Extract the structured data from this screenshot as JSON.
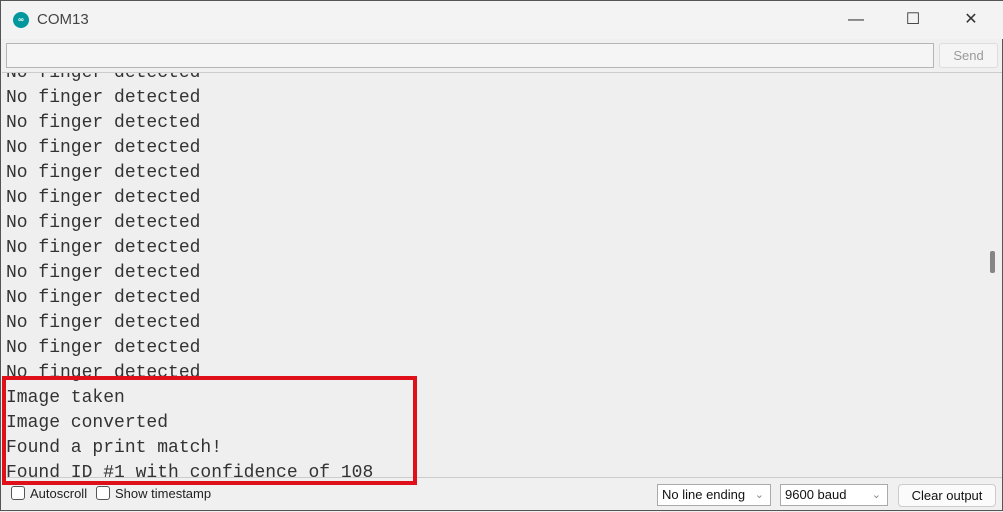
{
  "window": {
    "title": "COM13",
    "logo": "arduino-logo",
    "minimize": "—",
    "maximize": "☐",
    "close": "✕"
  },
  "input": {
    "value": "",
    "send_label": "Send"
  },
  "output": {
    "lines": [
      "No finger detected",
      "No finger detected",
      "No finger detected",
      "No finger detected",
      "No finger detected",
      "No finger detected",
      "No finger detected",
      "No finger detected",
      "No finger detected",
      "No finger detected",
      "No finger detected",
      "No finger detected",
      "No finger detected",
      "Image taken",
      "Image converted",
      "Found a print match!",
      "Found ID #1 with confidence of 108"
    ],
    "highlight_color": "#e0101a"
  },
  "bottom": {
    "autoscroll_label": "Autoscroll",
    "timestamp_label": "Show timestamp",
    "line_ending": "No line ending",
    "baud": "9600 baud",
    "clear_label": "Clear output"
  }
}
